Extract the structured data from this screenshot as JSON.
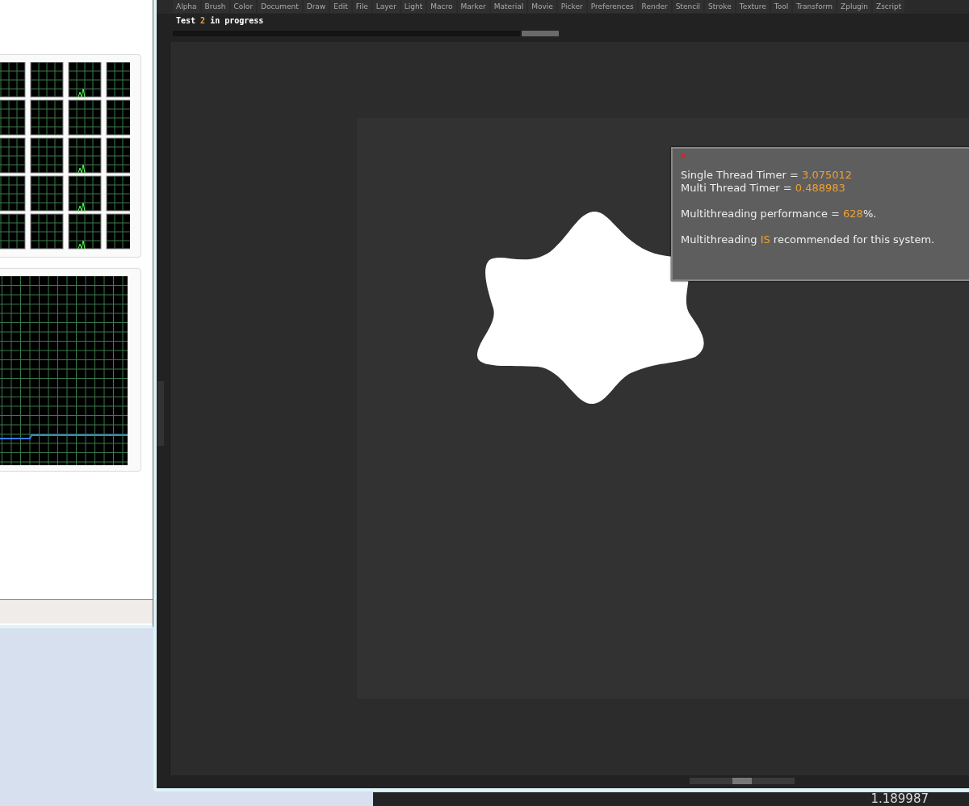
{
  "menu_bar": {
    "items": [
      "Alpha",
      "Brush",
      "Color",
      "Document",
      "Draw",
      "Edit",
      "File",
      "Layer",
      "Light",
      "Macro",
      "Marker",
      "Material",
      "Movie",
      "Picker",
      "Preferences",
      "Render",
      "Stencil",
      "Stroke",
      "Texture",
      "Tool",
      "Transform",
      "Zplugin",
      "Zscript"
    ]
  },
  "progress": {
    "level": 0.9,
    "segments": [
      {
        "text": "Test ",
        "highlight": false
      },
      {
        "text": "2",
        "highlight": true
      },
      {
        "text": " in progress",
        "highlight": false
      }
    ]
  },
  "result_popup": {
    "lines": [
      [
        {
          "text": "Single Thread Timer = ",
          "highlight": false
        },
        {
          "text": "3.075012",
          "highlight": true
        }
      ],
      [
        {
          "text": "Multi Thread Timer = ",
          "highlight": false
        },
        {
          "text": "0.488983",
          "highlight": true
        }
      ],
      [
        {
          "text": "Multithreading performance = ",
          "highlight": false
        },
        {
          "text": "628",
          "highlight": true
        },
        {
          "text": "%.",
          "highlight": false
        }
      ],
      [
        {
          "text": "Multithreading ",
          "highlight": false
        },
        {
          "text": "IS",
          "highlight": true
        },
        {
          "text": " recommended for this system.",
          "highlight": false
        }
      ]
    ]
  },
  "bottom_panel": {
    "value": "1.189987"
  }
}
